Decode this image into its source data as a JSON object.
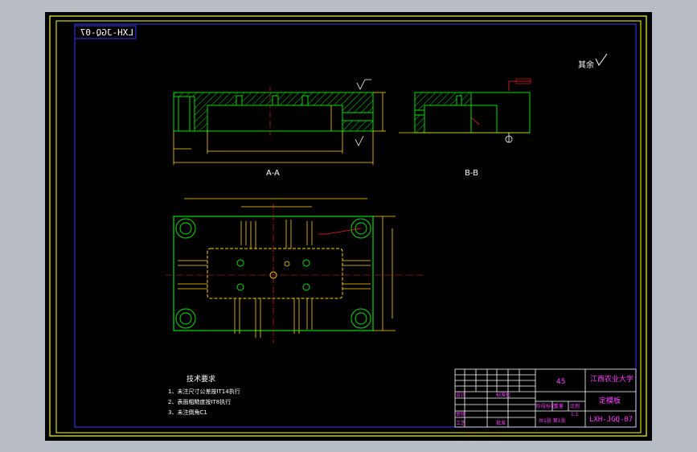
{
  "drawing": {
    "number_mirrored": "LXH-JGQ-07",
    "roughness_symbol_label": "其余",
    "section_labels": {
      "aa": "A-A",
      "bb": "B-B"
    },
    "tech_requirements": {
      "title": "技术要求",
      "items": [
        "1、未注尺寸公差按IT14执行",
        "2、表面粗糙度按IT8执行",
        "3、未注倒角C1"
      ]
    },
    "title_block": {
      "material": "45",
      "university": "江西农业大学",
      "part_name": "定模板",
      "drawing_no": "LXH-JGQ-07",
      "scale": "1:1",
      "label_stage": "阶段标记",
      "label_weight": "重量",
      "label_scale": "比例",
      "sheet_info": "共1张 第1张",
      "label_designer": "设计",
      "label_review": "审核",
      "label_process": "工艺",
      "label_standard": "标准化",
      "label_approve": "批准"
    }
  },
  "colors": {
    "frame_yellow": "#ffff00",
    "frame_blue": "#3a3aff",
    "outline_green": "#00dd00",
    "dim_yellow": "#ffd400",
    "center_red": "#ff2020",
    "white": "#ffffff",
    "magenta": "#ff40ff"
  }
}
